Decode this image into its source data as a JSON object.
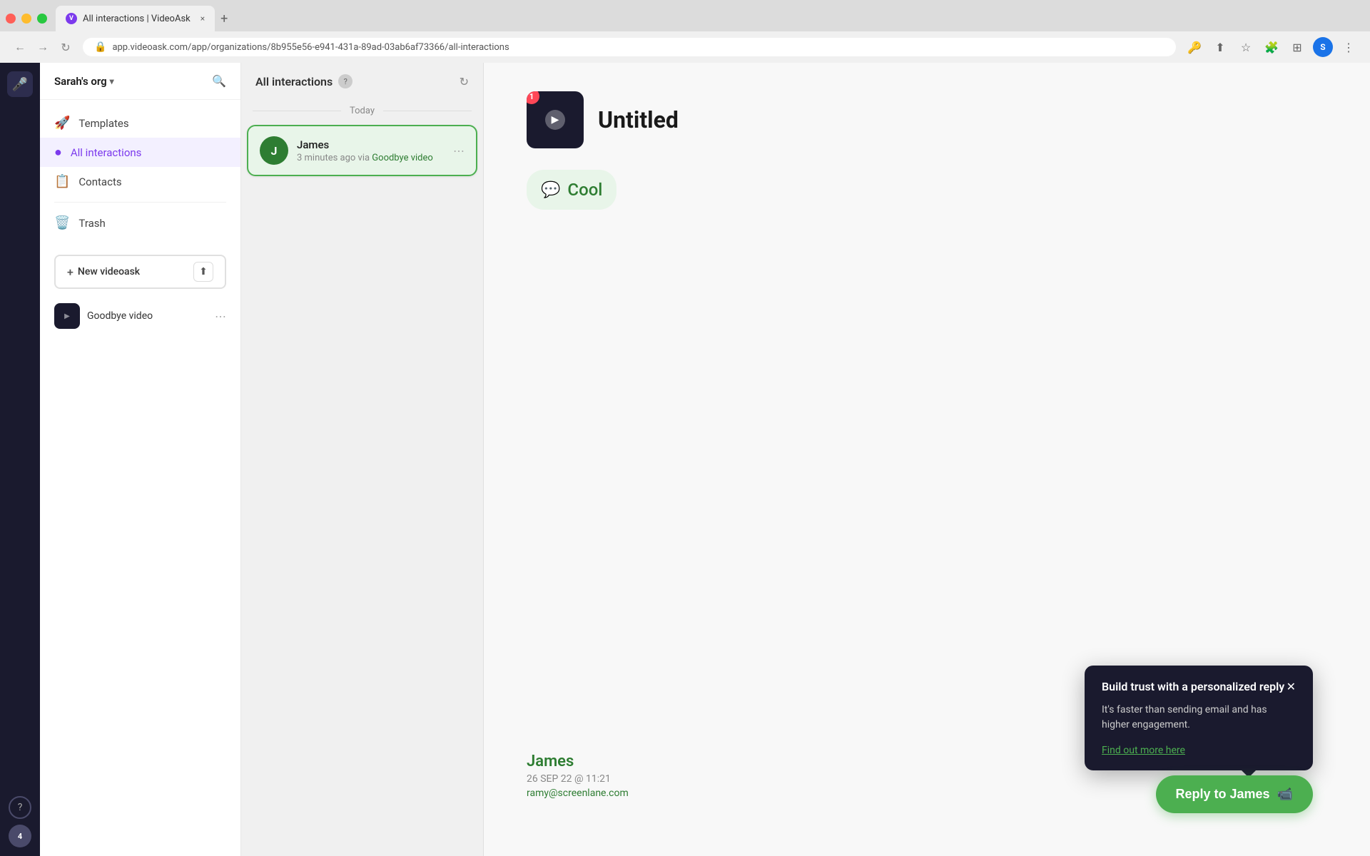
{
  "browser": {
    "tab_title": "All interactions | VideoAsk",
    "url": "app.videoask.com/app/organizations/8b955e56-e941-431a-89ad-03ab6af73366/all-interactions",
    "new_tab_label": "+",
    "close_tab_label": "×"
  },
  "sidebar": {
    "org_name": "Sarah's org",
    "items": [
      {
        "id": "templates",
        "label": "Templates",
        "icon": "🚀"
      },
      {
        "id": "all-interactions",
        "label": "All interactions",
        "icon": "🔵",
        "active": true
      },
      {
        "id": "contacts",
        "label": "Contacts",
        "icon": "📋"
      },
      {
        "id": "trash",
        "label": "Trash",
        "icon": "🗑️"
      }
    ],
    "new_videoask_label": "New videoask",
    "videoasks": [
      {
        "id": "goodbye-video",
        "name": "Goodbye video",
        "thumb_color": "#1a1a2e"
      }
    ]
  },
  "middle_panel": {
    "title": "All interactions",
    "date_section": "Today",
    "items": [
      {
        "id": "james",
        "name": "James",
        "time": "3 minutes ago via ",
        "via": "Goodbye video",
        "avatar_letter": "J",
        "avatar_color": "#2e7d32",
        "selected": true
      }
    ]
  },
  "main": {
    "videoask_title": "Untitled",
    "badge_count": "1",
    "response": {
      "icon": "💬",
      "text": "Cool"
    },
    "contact": {
      "name": "James",
      "date": "26 SEP 22 @ 11:21",
      "email": "ramy@screenlane.com"
    },
    "reply_button": "Reply to James"
  },
  "tooltip": {
    "title": "Build trust with a personalized reply",
    "body": "It's faster than sending email and has higher engagement.",
    "link": "Find out more here"
  },
  "far_left": {
    "help_label": "?",
    "badge_label": "4"
  }
}
